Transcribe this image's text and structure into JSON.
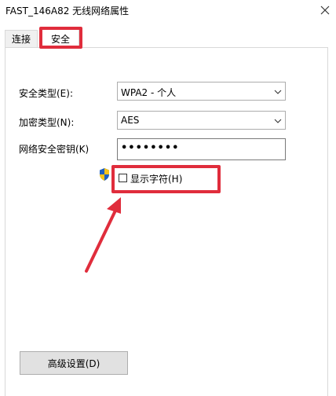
{
  "window": {
    "title": "FAST_146A82 无线网络属性"
  },
  "tabs": [
    {
      "label": "连接",
      "active": false
    },
    {
      "label": "安全",
      "active": true
    }
  ],
  "security": {
    "type_label": "安全类型(E):",
    "type_value": "WPA2 - 个人",
    "encryption_label": "加密类型(N):",
    "encryption_value": "AES",
    "key_label": "网络安全密钥(K)",
    "key_value": "••••••••",
    "show_chars_label": "显示字符(H)",
    "show_chars_checked": false
  },
  "buttons": {
    "advanced": "高级设置(D)"
  },
  "annotation_color": "#e02d3c",
  "icons": [
    "close-icon",
    "chevron-down-icon",
    "uac-shield-icon",
    "red-arrow"
  ]
}
